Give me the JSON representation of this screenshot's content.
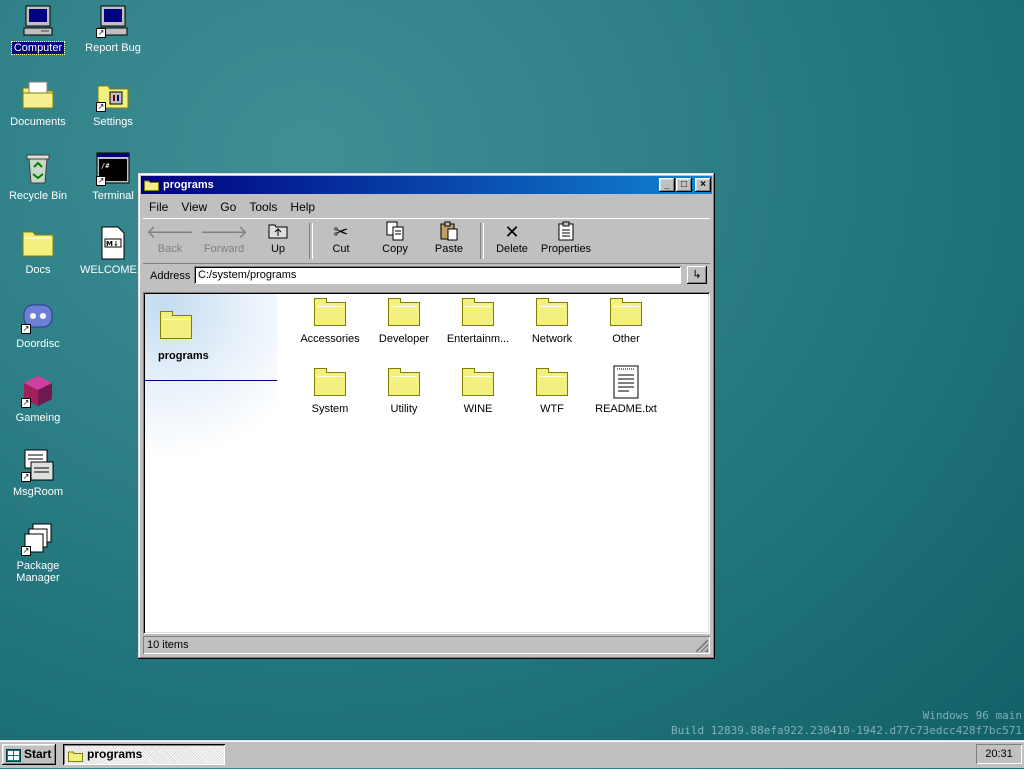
{
  "desktop": {
    "icons": [
      {
        "label": "Computer",
        "icon": "computer-icon"
      },
      {
        "label": "Report Bug",
        "icon": "report-bug-icon"
      },
      {
        "label": "Documents",
        "icon": "documents-icon"
      },
      {
        "label": "Settings",
        "icon": "settings-icon"
      },
      {
        "label": "Recycle Bin",
        "icon": "recycle-bin-icon"
      },
      {
        "label": "Terminal",
        "icon": "terminal-icon"
      },
      {
        "label": "Docs",
        "icon": "folder-icon"
      },
      {
        "label": "WELCOME...",
        "icon": "markdown-file-icon"
      },
      {
        "label": "Doordisc",
        "icon": "doordisc-icon"
      },
      {
        "label": "Gameing",
        "icon": "gameing-icon"
      },
      {
        "label": "MsgRoom",
        "icon": "msgroom-icon"
      },
      {
        "label": "Package Manager",
        "icon": "package-manager-icon"
      }
    ],
    "watermark": {
      "line1": "Windows 96 main",
      "line2": "Build 12839.88efa922.230410-1942.d77c73edcc428f7bc571"
    }
  },
  "window": {
    "title": "programs",
    "controls": {
      "minimize": "_",
      "maximize": "□",
      "close": "×"
    },
    "menu": [
      "File",
      "View",
      "Go",
      "Tools",
      "Help"
    ],
    "toolbar": {
      "back": "Back",
      "forward": "Forward",
      "up": "Up",
      "cut": "Cut",
      "copy": "Copy",
      "paste": "Paste",
      "delete": "Delete",
      "properties": "Properties"
    },
    "address": {
      "label": "Address",
      "value": "C:/system/programs"
    },
    "side_pane": {
      "title": "programs"
    },
    "files": [
      {
        "name": "Accessories",
        "type": "folder"
      },
      {
        "name": "Developer",
        "type": "folder"
      },
      {
        "name": "Entertainm...",
        "type": "folder"
      },
      {
        "name": "Network",
        "type": "folder"
      },
      {
        "name": "Other",
        "type": "folder"
      },
      {
        "name": "System",
        "type": "folder"
      },
      {
        "name": "Utility",
        "type": "folder"
      },
      {
        "name": "WINE",
        "type": "folder"
      },
      {
        "name": "WTF",
        "type": "folder"
      },
      {
        "name": "README.txt",
        "type": "text-file"
      }
    ],
    "status": "10 items"
  },
  "taskbar": {
    "start_label": "Start",
    "task_label": "programs",
    "clock": "20:31"
  },
  "colors": {
    "desktop": "#1d7076",
    "title_start": "#000080",
    "title_end": "#1084d0",
    "folder": "#f4f080",
    "chrome": "#c0c0c0"
  }
}
